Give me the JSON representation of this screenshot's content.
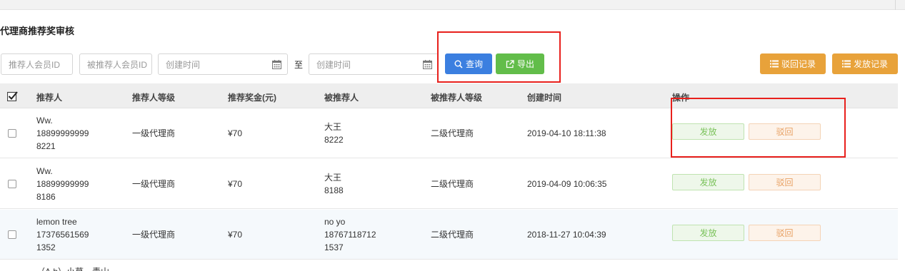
{
  "page_title": "代理商推荐奖审核",
  "filters": {
    "referrer_id_placeholder": "推荐人会员ID",
    "referee_id_placeholder": "被推荐人会员ID",
    "created_from_placeholder": "创建时间",
    "to_label": "至",
    "created_to_placeholder": "创建时间"
  },
  "toolbar": {
    "search_label": "查询",
    "export_label": "导出",
    "reject_records_label": "驳回记录",
    "payout_records_label": "发放记录"
  },
  "colors": {
    "primary_blue": "#3b7fe0",
    "export_green": "#62bd4a",
    "orange": "#e8a23a",
    "highlight_red": "#e8201c"
  },
  "table": {
    "headers": [
      "推荐人",
      "推荐人等级",
      "推荐奖金(元)",
      "被推荐人",
      "被推荐人等级",
      "创建时间",
      "操作"
    ],
    "rows": [
      {
        "referrer": [
          "Ww.",
          "18899999999",
          "8221"
        ],
        "referrer_level": "一级代理商",
        "bonus": "¥70",
        "referee": [
          "大王",
          "8222"
        ],
        "referee_level": "二级代理商",
        "created": "2019-04-10 18:11:38",
        "actions": [
          "发放",
          "驳回"
        ]
      },
      {
        "referrer": [
          "Ww.",
          "18899999999",
          "8186"
        ],
        "referrer_level": "一级代理商",
        "bonus": "¥70",
        "referee": [
          "大王",
          "8188"
        ],
        "referee_level": "二级代理商",
        "created": "2019-04-09 10:06:35",
        "actions": [
          "发放",
          "驳回"
        ]
      },
      {
        "referrer": [
          "lemon tree",
          "17376561569",
          "1352"
        ],
        "referrer_level": "一级代理商",
        "bonus": "¥70",
        "referee": [
          "no yo",
          "18767118712",
          "1537"
        ],
        "referee_level": "二级代理商",
        "created": "2018-11-27 10:04:39",
        "actions": [
          "发放",
          "驳回"
        ]
      }
    ],
    "partial_row_text": "（A.b）小草一青山"
  }
}
